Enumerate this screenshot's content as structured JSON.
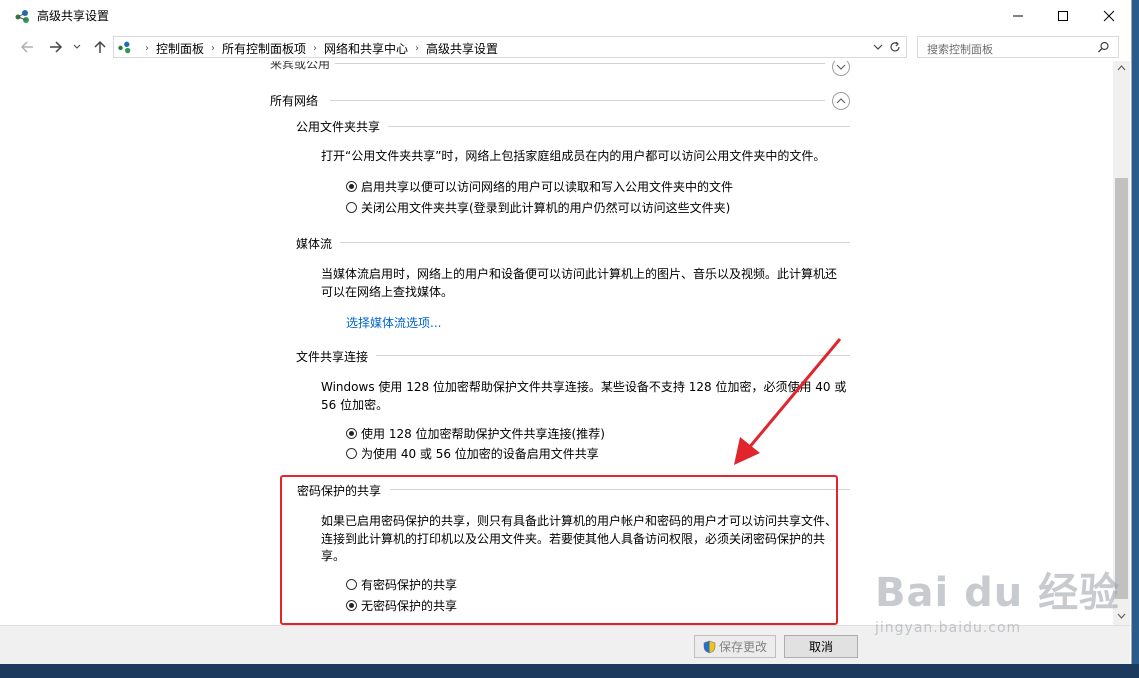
{
  "window": {
    "title": "高级共享设置"
  },
  "address": {
    "breadcrumbs": [
      "控制面板",
      "所有控制面板项",
      "网络和共享中心",
      "高级共享设置"
    ],
    "search_placeholder": "搜索控制面板"
  },
  "content": {
    "top_partial_label": "来宾或公用",
    "group_label": "所有网络",
    "sections": {
      "public_folder": {
        "title": "公用文件夹共享",
        "description": "打开“公用文件夹共享”时，网络上包括家庭组成员在内的用户都可以访问公用文件夹中的文件。",
        "options": [
          {
            "label": "启用共享以便可以访问网络的用户可以读取和写入公用文件夹中的文件",
            "checked": true
          },
          {
            "label": "关闭公用文件夹共享(登录到此计算机的用户仍然可以访问这些文件夹)",
            "checked": false
          }
        ]
      },
      "media": {
        "title": "媒体流",
        "description_line1": "当媒体流启用时，网络上的用户和设备便可以访问此计算机上的图片、音乐以及视频。此计算机还",
        "description_line2": "可以在网络上查找媒体。",
        "link": "选择媒体流选项..."
      },
      "file_sharing": {
        "title": "文件共享连接",
        "description_line1": "Windows 使用 128 位加密帮助保护文件共享连接。某些设备不支持 128 位加密，必须使用 40 或",
        "description_line2": "56 位加密。",
        "options": [
          {
            "label": "使用 128 位加密帮助保护文件共享连接(推荐)",
            "checked": true
          },
          {
            "label": "为使用 40 或 56 位加密的设备启用文件共享",
            "checked": false
          }
        ]
      },
      "password": {
        "title": "密码保护的共享",
        "description_line1": "如果已启用密码保护的共享，则只有具备此计算机的用户帐户和密码的用户才可以访问共享文件、",
        "description_line2": "连接到此计算机的打印机以及公用文件夹。若要使其他人具备访问权限，必须关闭密码保护的共",
        "description_line3": "享。",
        "options": [
          {
            "label": "有密码保护的共享",
            "checked": false
          },
          {
            "label": "无密码保护的共享",
            "checked": true
          }
        ]
      }
    }
  },
  "footer": {
    "save_label": "保存更改",
    "cancel_label": "取消"
  },
  "watermark": {
    "brand": "Bai du 经验",
    "url": "jingyan.baidu.com"
  },
  "colors": {
    "annotation": "#e0252d",
    "link": "#0066cc"
  }
}
